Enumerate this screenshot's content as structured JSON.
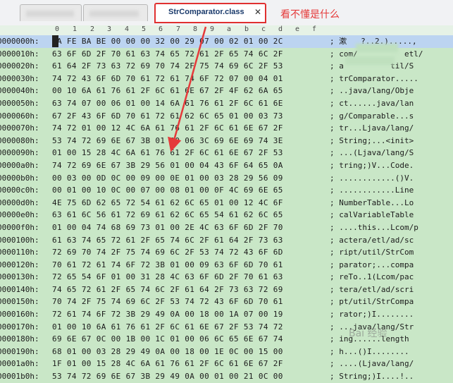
{
  "tabs": [
    {
      "label": ""
    },
    {
      "label": ""
    },
    {
      "label": "StrComparator.class",
      "close": "✕"
    }
  ],
  "annotation": "看不懂是什么",
  "ruler": [
    "0",
    "1",
    "2",
    "3",
    "4",
    "5",
    "6",
    "7",
    "8",
    "9",
    "a",
    "b",
    "c",
    "d",
    "e",
    "f"
  ],
  "rows": [
    {
      "offset": "0000000h:",
      "hex": "CA FE BA BE 00 00 00 32 00 29 07 00 02 01 00 2C",
      "ascii": "; 漱   ?..2.).....,"
    },
    {
      "offset": "0000010h:",
      "hex": "63 6F 6D 2F 70 61 63 74 65 72 61 2F 65 74 6C 2F",
      "ascii": "; com/          etl/"
    },
    {
      "offset": "0000020h:",
      "hex": "61 64 2F 73 63 72 69 70 74 2F 75 74 69 6C 2F 53",
      "ascii": "; a          til/S"
    },
    {
      "offset": "0000030h:",
      "hex": "74 72 43 6F 6D 70 61 72 61 74 6F 72 07 00 04 01",
      "ascii": "; trComparator....."
    },
    {
      "offset": "0000040h:",
      "hex": "00 10 6A 61 76 61 2F 6C 61 6E 67 2F 4F 62 6A 65",
      "ascii": "; ..java/lang/Obje"
    },
    {
      "offset": "0000050h:",
      "hex": "63 74 07 00 06 01 00 14 6A 61 76 61 2F 6C 61 6E",
      "ascii": "; ct......java/lan"
    },
    {
      "offset": "0000060h:",
      "hex": "67 2F 43 6F 6D 70 61 72 61 62 6C 65 01 00 03 73",
      "ascii": "; g/Comparable...s"
    },
    {
      "offset": "0000070h:",
      "hex": "74 72 01 00 12 4C 6A 61 76 61 2F 6C 61 6E 67 2F",
      "ascii": "; tr...Ljava/lang/"
    },
    {
      "offset": "0000080h:",
      "hex": "53 74 72 69 6E 67 3B 01 00 06 3C 69 6E 69 74 3E",
      "ascii": "; String;...<init>"
    },
    {
      "offset": "0000090h:",
      "hex": "01 00 15 28 4C 6A 61 76 61 2F 6C 61 6E 67 2F 53",
      "ascii": "; ...(Ljava/lang/S"
    },
    {
      "offset": "00000a0h:",
      "hex": "74 72 69 6E 67 3B 29 56 01 00 04 43 6F 64 65 0A",
      "ascii": "; tring;)V...Code."
    },
    {
      "offset": "00000b0h:",
      "hex": "00 03 00 0D 0C 00 09 00 0E 01 00 03 28 29 56 09",
      "ascii": "; ............()V."
    },
    {
      "offset": "00000c0h:",
      "hex": "00 01 00 10 0C 00 07 00 08 01 00 0F 4C 69 6E 65",
      "ascii": "; ............Line"
    },
    {
      "offset": "00000d0h:",
      "hex": "4E 75 6D 62 65 72 54 61 62 6C 65 01 00 12 4C 6F",
      "ascii": "; NumberTable...Lo"
    },
    {
      "offset": "00000e0h:",
      "hex": "63 61 6C 56 61 72 69 61 62 6C 65 54 61 62 6C 65",
      "ascii": "; calVariableTable"
    },
    {
      "offset": "00000f0h:",
      "hex": "01 00 04 74 68 69 73 01 00 2E 4C 63 6F 6D 2F 70",
      "ascii": "; ....this...Lcom/p"
    },
    {
      "offset": "0000100h:",
      "hex": "61 63 74 65 72 61 2F 65 74 6C 2F 61 64 2F 73 63",
      "ascii": "; actera/etl/ad/sc"
    },
    {
      "offset": "0000110h:",
      "hex": "72 69 70 74 2F 75 74 69 6C 2F 53 74 72 43 6F 6D",
      "ascii": "; ript/util/StrCom"
    },
    {
      "offset": "0000120h:",
      "hex": "70 61 72 61 74 6F 72 3B 01 00 09 63 6F 6D 70 61",
      "ascii": "; parator;...compa"
    },
    {
      "offset": "0000130h:",
      "hex": "72 65 54 6F 01 00 31 28 4C 63 6F 6D 2F 70 61 63",
      "ascii": "; reTo..1(Lcom/pac"
    },
    {
      "offset": "0000140h:",
      "hex": "74 65 72 61 2F 65 74 6C 2F 61 64 2F 73 63 72 69",
      "ascii": "; tera/etl/ad/scri"
    },
    {
      "offset": "0000150h:",
      "hex": "70 74 2F 75 74 69 6C 2F 53 74 72 43 6F 6D 70 61",
      "ascii": "; pt/util/StrCompa"
    },
    {
      "offset": "0000160h:",
      "hex": "72 61 74 6F 72 3B 29 49 0A 00 18 00 1A 07 00 19",
      "ascii": "; rator;)I........"
    },
    {
      "offset": "0000170h:",
      "hex": "01 00 10 6A 61 76 61 2F 6C 61 6E 67 2F 53 74 72",
      "ascii": "; ...java/lang/Str"
    },
    {
      "offset": "0000180h:",
      "hex": "69 6E 67 0C 00 1B 00 1C 01 00 06 6C 65 6E 67 74",
      "ascii": "; ing......length"
    },
    {
      "offset": "0000190h:",
      "hex": "68 01 00 03 28 29 49 0A 00 18 00 1E 0C 00 15 00",
      "ascii": "; h...()I........"
    },
    {
      "offset": "00001a0h:",
      "hex": "1F 01 00 15 28 4C 6A 61 76 61 2F 6C 61 6E 67 2F",
      "ascii": "; ....(Ljava/lang/"
    },
    {
      "offset": "00001b0h:",
      "hex": "53 74 72 69 6E 67 3B 29 49 0A 00 01 00 21 0C 00",
      "ascii": "; String;)I....!.."
    }
  ],
  "watermark": "Bai 经验",
  "colors": {
    "background": "#c9e7c7",
    "highlight": "#bcd4f1",
    "annotation": "#e53a3a"
  }
}
